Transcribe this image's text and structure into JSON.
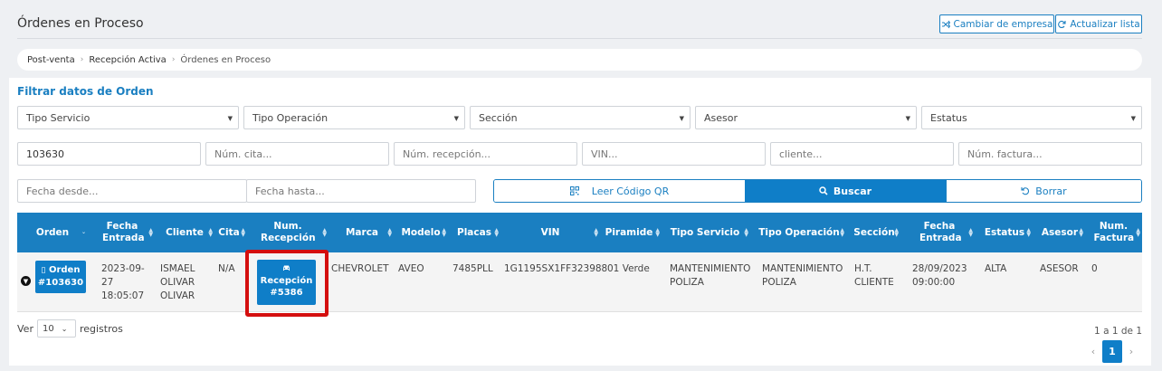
{
  "page": {
    "title": "Órdenes en Proceso"
  },
  "header": {
    "change_company": "Cambiar de empresa",
    "refresh_list": "Actualizar lista"
  },
  "breadcrumb": [
    "Post-venta",
    "Recepción Activa",
    "Órdenes en Proceso"
  ],
  "filters": {
    "title": "Filtrar datos de Orden",
    "selects": [
      "Tipo Servicio",
      "Tipo Operación",
      "Sección",
      "Asesor",
      "Estatus"
    ],
    "order_value": "103630",
    "placeholders": {
      "cita": "Núm. cita...",
      "recepcion": "Núm. recepción...",
      "vin": "VIN...",
      "cliente": "cliente...",
      "factura": "Núm. factura...",
      "fecha_desde": "Fecha desde...",
      "fecha_hasta": "Fecha hasta..."
    },
    "qr_label": "Leer Código QR",
    "search_label": "Buscar",
    "clear_label": "Borrar"
  },
  "table": {
    "columns": [
      "Orden",
      "Fecha Entrada",
      "Cliente",
      "Cita",
      "Num. Recepción",
      "Marca",
      "Modelo",
      "Placas",
      "VIN",
      "Piramide",
      "Tipo Servicio",
      "Tipo Operación",
      "Sección",
      "Fecha Entrada",
      "Estatus",
      "Asesor",
      "Num. Factura"
    ],
    "row": {
      "orden_label": "Orden",
      "orden_num": "#103630",
      "fecha_entrada": "2023-09-27 18:05:07",
      "cliente": "ISMAEL OLIVAR OLIVAR",
      "cita": "N/A",
      "recepcion_label": "Recepción",
      "recepcion_num": "#5386",
      "marca": "CHEVROLET",
      "modelo": "AVEO",
      "placas": "7485PLL",
      "vin": "1G1195SX1FF323988",
      "piramide": "01 Verde",
      "tipo_servicio": "MANTENIMIENTO POLIZA",
      "tipo_operacion": "MANTENIMIENTO POLIZA",
      "seccion": "H.T. CLIENTE",
      "fecha_entrada2": "28/09/2023 09:00:00",
      "estatus": "ALTA",
      "asesor": "ASESOR",
      "factura": "0"
    }
  },
  "footer": {
    "ver": "Ver",
    "page_size": "10",
    "registros": "registros",
    "count": "1 a 1 de 1",
    "current_page": "1"
  }
}
